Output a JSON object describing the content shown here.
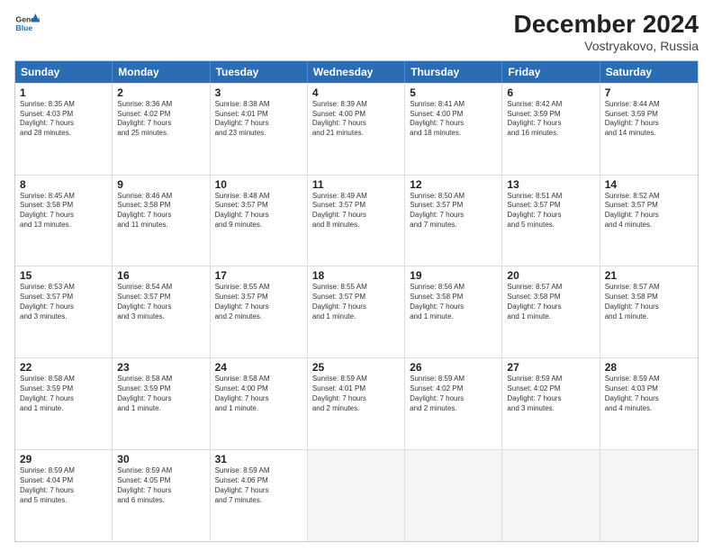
{
  "header": {
    "logo": {
      "general": "General",
      "blue": "Blue"
    },
    "title": "December 2024",
    "subtitle": "Vostryakovo, Russia"
  },
  "calendar": {
    "days_of_week": [
      "Sunday",
      "Monday",
      "Tuesday",
      "Wednesday",
      "Thursday",
      "Friday",
      "Saturday"
    ],
    "weeks": [
      [
        {
          "day": "1",
          "lines": [
            "Sunrise: 8:35 AM",
            "Sunset: 4:03 PM",
            "Daylight: 7 hours",
            "and 28 minutes."
          ]
        },
        {
          "day": "2",
          "lines": [
            "Sunrise: 8:36 AM",
            "Sunset: 4:02 PM",
            "Daylight: 7 hours",
            "and 25 minutes."
          ]
        },
        {
          "day": "3",
          "lines": [
            "Sunrise: 8:38 AM",
            "Sunset: 4:01 PM",
            "Daylight: 7 hours",
            "and 23 minutes."
          ]
        },
        {
          "day": "4",
          "lines": [
            "Sunrise: 8:39 AM",
            "Sunset: 4:00 PM",
            "Daylight: 7 hours",
            "and 21 minutes."
          ]
        },
        {
          "day": "5",
          "lines": [
            "Sunrise: 8:41 AM",
            "Sunset: 4:00 PM",
            "Daylight: 7 hours",
            "and 18 minutes."
          ]
        },
        {
          "day": "6",
          "lines": [
            "Sunrise: 8:42 AM",
            "Sunset: 3:59 PM",
            "Daylight: 7 hours",
            "and 16 minutes."
          ]
        },
        {
          "day": "7",
          "lines": [
            "Sunrise: 8:44 AM",
            "Sunset: 3:59 PM",
            "Daylight: 7 hours",
            "and 14 minutes."
          ]
        }
      ],
      [
        {
          "day": "8",
          "lines": [
            "Sunrise: 8:45 AM",
            "Sunset: 3:58 PM",
            "Daylight: 7 hours",
            "and 13 minutes."
          ]
        },
        {
          "day": "9",
          "lines": [
            "Sunrise: 8:46 AM",
            "Sunset: 3:58 PM",
            "Daylight: 7 hours",
            "and 11 minutes."
          ]
        },
        {
          "day": "10",
          "lines": [
            "Sunrise: 8:48 AM",
            "Sunset: 3:57 PM",
            "Daylight: 7 hours",
            "and 9 minutes."
          ]
        },
        {
          "day": "11",
          "lines": [
            "Sunrise: 8:49 AM",
            "Sunset: 3:57 PM",
            "Daylight: 7 hours",
            "and 8 minutes."
          ]
        },
        {
          "day": "12",
          "lines": [
            "Sunrise: 8:50 AM",
            "Sunset: 3:57 PM",
            "Daylight: 7 hours",
            "and 7 minutes."
          ]
        },
        {
          "day": "13",
          "lines": [
            "Sunrise: 8:51 AM",
            "Sunset: 3:57 PM",
            "Daylight: 7 hours",
            "and 5 minutes."
          ]
        },
        {
          "day": "14",
          "lines": [
            "Sunrise: 8:52 AM",
            "Sunset: 3:57 PM",
            "Daylight: 7 hours",
            "and 4 minutes."
          ]
        }
      ],
      [
        {
          "day": "15",
          "lines": [
            "Sunrise: 8:53 AM",
            "Sunset: 3:57 PM",
            "Daylight: 7 hours",
            "and 3 minutes."
          ]
        },
        {
          "day": "16",
          "lines": [
            "Sunrise: 8:54 AM",
            "Sunset: 3:57 PM",
            "Daylight: 7 hours",
            "and 3 minutes."
          ]
        },
        {
          "day": "17",
          "lines": [
            "Sunrise: 8:55 AM",
            "Sunset: 3:57 PM",
            "Daylight: 7 hours",
            "and 2 minutes."
          ]
        },
        {
          "day": "18",
          "lines": [
            "Sunrise: 8:55 AM",
            "Sunset: 3:57 PM",
            "Daylight: 7 hours",
            "and 1 minute."
          ]
        },
        {
          "day": "19",
          "lines": [
            "Sunrise: 8:56 AM",
            "Sunset: 3:58 PM",
            "Daylight: 7 hours",
            "and 1 minute."
          ]
        },
        {
          "day": "20",
          "lines": [
            "Sunrise: 8:57 AM",
            "Sunset: 3:58 PM",
            "Daylight: 7 hours",
            "and 1 minute."
          ]
        },
        {
          "day": "21",
          "lines": [
            "Sunrise: 8:57 AM",
            "Sunset: 3:58 PM",
            "Daylight: 7 hours",
            "and 1 minute."
          ]
        }
      ],
      [
        {
          "day": "22",
          "lines": [
            "Sunrise: 8:58 AM",
            "Sunset: 3:59 PM",
            "Daylight: 7 hours",
            "and 1 minute."
          ]
        },
        {
          "day": "23",
          "lines": [
            "Sunrise: 8:58 AM",
            "Sunset: 3:59 PM",
            "Daylight: 7 hours",
            "and 1 minute."
          ]
        },
        {
          "day": "24",
          "lines": [
            "Sunrise: 8:58 AM",
            "Sunset: 4:00 PM",
            "Daylight: 7 hours",
            "and 1 minute."
          ]
        },
        {
          "day": "25",
          "lines": [
            "Sunrise: 8:59 AM",
            "Sunset: 4:01 PM",
            "Daylight: 7 hours",
            "and 2 minutes."
          ]
        },
        {
          "day": "26",
          "lines": [
            "Sunrise: 8:59 AM",
            "Sunset: 4:02 PM",
            "Daylight: 7 hours",
            "and 2 minutes."
          ]
        },
        {
          "day": "27",
          "lines": [
            "Sunrise: 8:59 AM",
            "Sunset: 4:02 PM",
            "Daylight: 7 hours",
            "and 3 minutes."
          ]
        },
        {
          "day": "28",
          "lines": [
            "Sunrise: 8:59 AM",
            "Sunset: 4:03 PM",
            "Daylight: 7 hours",
            "and 4 minutes."
          ]
        }
      ],
      [
        {
          "day": "29",
          "lines": [
            "Sunrise: 8:59 AM",
            "Sunset: 4:04 PM",
            "Daylight: 7 hours",
            "and 5 minutes."
          ]
        },
        {
          "day": "30",
          "lines": [
            "Sunrise: 8:59 AM",
            "Sunset: 4:05 PM",
            "Daylight: 7 hours",
            "and 6 minutes."
          ]
        },
        {
          "day": "31",
          "lines": [
            "Sunrise: 8:59 AM",
            "Sunset: 4:06 PM",
            "Daylight: 7 hours",
            "and 7 minutes."
          ]
        },
        {
          "day": "",
          "lines": []
        },
        {
          "day": "",
          "lines": []
        },
        {
          "day": "",
          "lines": []
        },
        {
          "day": "",
          "lines": []
        }
      ]
    ]
  }
}
